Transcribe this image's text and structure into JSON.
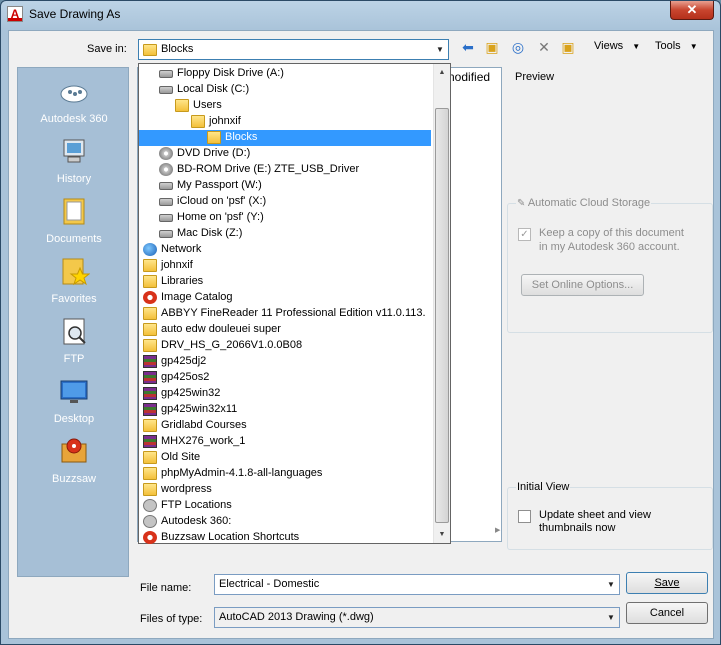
{
  "window": {
    "title": "Save Drawing As",
    "close": "✕"
  },
  "toolbar": {
    "save_in_label": "Save in:",
    "save_in_value": "Blocks",
    "views_label": "Views",
    "tools_label": "Tools"
  },
  "places": [
    {
      "label": "Autodesk 360",
      "icon": "cloud-icon"
    },
    {
      "label": "History",
      "icon": "history-icon"
    },
    {
      "label": "Documents",
      "icon": "documents-icon"
    },
    {
      "label": "Favorites",
      "icon": "favorites-icon"
    },
    {
      "label": "FTP",
      "icon": "ftp-icon"
    },
    {
      "label": "Desktop",
      "icon": "desktop-icon"
    },
    {
      "label": "Buzzsaw",
      "icon": "buzzsaw-icon"
    }
  ],
  "filelist": {
    "column_modified": "nodified"
  },
  "dropdown": {
    "items": [
      {
        "label": "Floppy Disk Drive (A:)",
        "icon": "floppy-icon",
        "indent": 2
      },
      {
        "label": "Local Disk (C:)",
        "icon": "drive-icon",
        "indent": 2
      },
      {
        "label": "Users",
        "icon": "folder-icon",
        "indent": 3
      },
      {
        "label": "johnxif",
        "icon": "folder-icon",
        "indent": 4
      },
      {
        "label": "Blocks",
        "icon": "folder-icon",
        "indent": 5,
        "selected": true
      },
      {
        "label": "DVD Drive (D:)",
        "icon": "disc-icon",
        "indent": 2
      },
      {
        "label": "BD-ROM Drive (E:) ZTE_USB_Driver",
        "icon": "disc-icon",
        "indent": 2
      },
      {
        "label": "My Passport (W:)",
        "icon": "drive-icon",
        "indent": 2
      },
      {
        "label": "iCloud on 'psf' (X:)",
        "icon": "network-drive-icon",
        "indent": 2
      },
      {
        "label": "Home on 'psf' (Y:)",
        "icon": "network-drive-icon",
        "indent": 2
      },
      {
        "label": "Mac Disk (Z:)",
        "icon": "network-drive-icon",
        "indent": 2
      },
      {
        "label": "Network",
        "icon": "network-icon",
        "indent": 1
      },
      {
        "label": "johnxif",
        "icon": "user-folder-icon",
        "indent": 1
      },
      {
        "label": "Libraries",
        "icon": "libraries-icon",
        "indent": 1
      },
      {
        "label": "Image Catalog",
        "icon": "image-catalog-icon",
        "indent": 1
      },
      {
        "label": "ABBYY FineReader 11 Professional Edition v11.0.113.",
        "icon": "folder-icon",
        "indent": 1
      },
      {
        "label": "auto edw douleuei super",
        "icon": "folder-icon",
        "indent": 1
      },
      {
        "label": "DRV_HS_G_2066V1.0.0B08",
        "icon": "folder-icon",
        "indent": 1
      },
      {
        "label": "gp425dj2",
        "icon": "archive-icon",
        "indent": 1
      },
      {
        "label": "gp425os2",
        "icon": "archive-icon",
        "indent": 1
      },
      {
        "label": "gp425win32",
        "icon": "archive-icon",
        "indent": 1
      },
      {
        "label": "gp425win32x11",
        "icon": "archive-icon",
        "indent": 1
      },
      {
        "label": "Gridlabd Courses",
        "icon": "folder-icon",
        "indent": 1
      },
      {
        "label": "MHX276_work_1",
        "icon": "archive-icon",
        "indent": 1
      },
      {
        "label": "Old Site",
        "icon": "folder-icon",
        "indent": 1
      },
      {
        "label": "phpMyAdmin-4.1.8-all-languages",
        "icon": "folder-icon",
        "indent": 1
      },
      {
        "label": "wordpress",
        "icon": "folder-icon",
        "indent": 1
      },
      {
        "label": "FTP Locations",
        "icon": "ftp-location-icon",
        "indent": 1
      },
      {
        "label": "Autodesk 360:",
        "icon": "cloud-icon",
        "indent": 1
      },
      {
        "label": "Buzzsaw Location Shortcuts",
        "icon": "buzzsaw-icon",
        "indent": 1
      }
    ]
  },
  "preview": {
    "title": "Preview"
  },
  "cloud": {
    "title": "Automatic Cloud Storage",
    "checkbox_label_1": "Keep a copy of this document",
    "checkbox_label_2": "in my Autodesk 360 account.",
    "checked": true,
    "options_button": "Set Online Options..."
  },
  "initial_view": {
    "title": "Initial View",
    "checkbox_label_1": "Update sheet and view",
    "checkbox_label_2": "thumbnails now",
    "checked": false
  },
  "footer": {
    "file_name_label": "File name:",
    "file_name_value": "Electrical - Domestic",
    "file_type_label": "Files of type:",
    "file_type_value": "AutoCAD 2013 Drawing (*.dwg)",
    "save_button": "Save",
    "cancel_button": "Cancel"
  }
}
